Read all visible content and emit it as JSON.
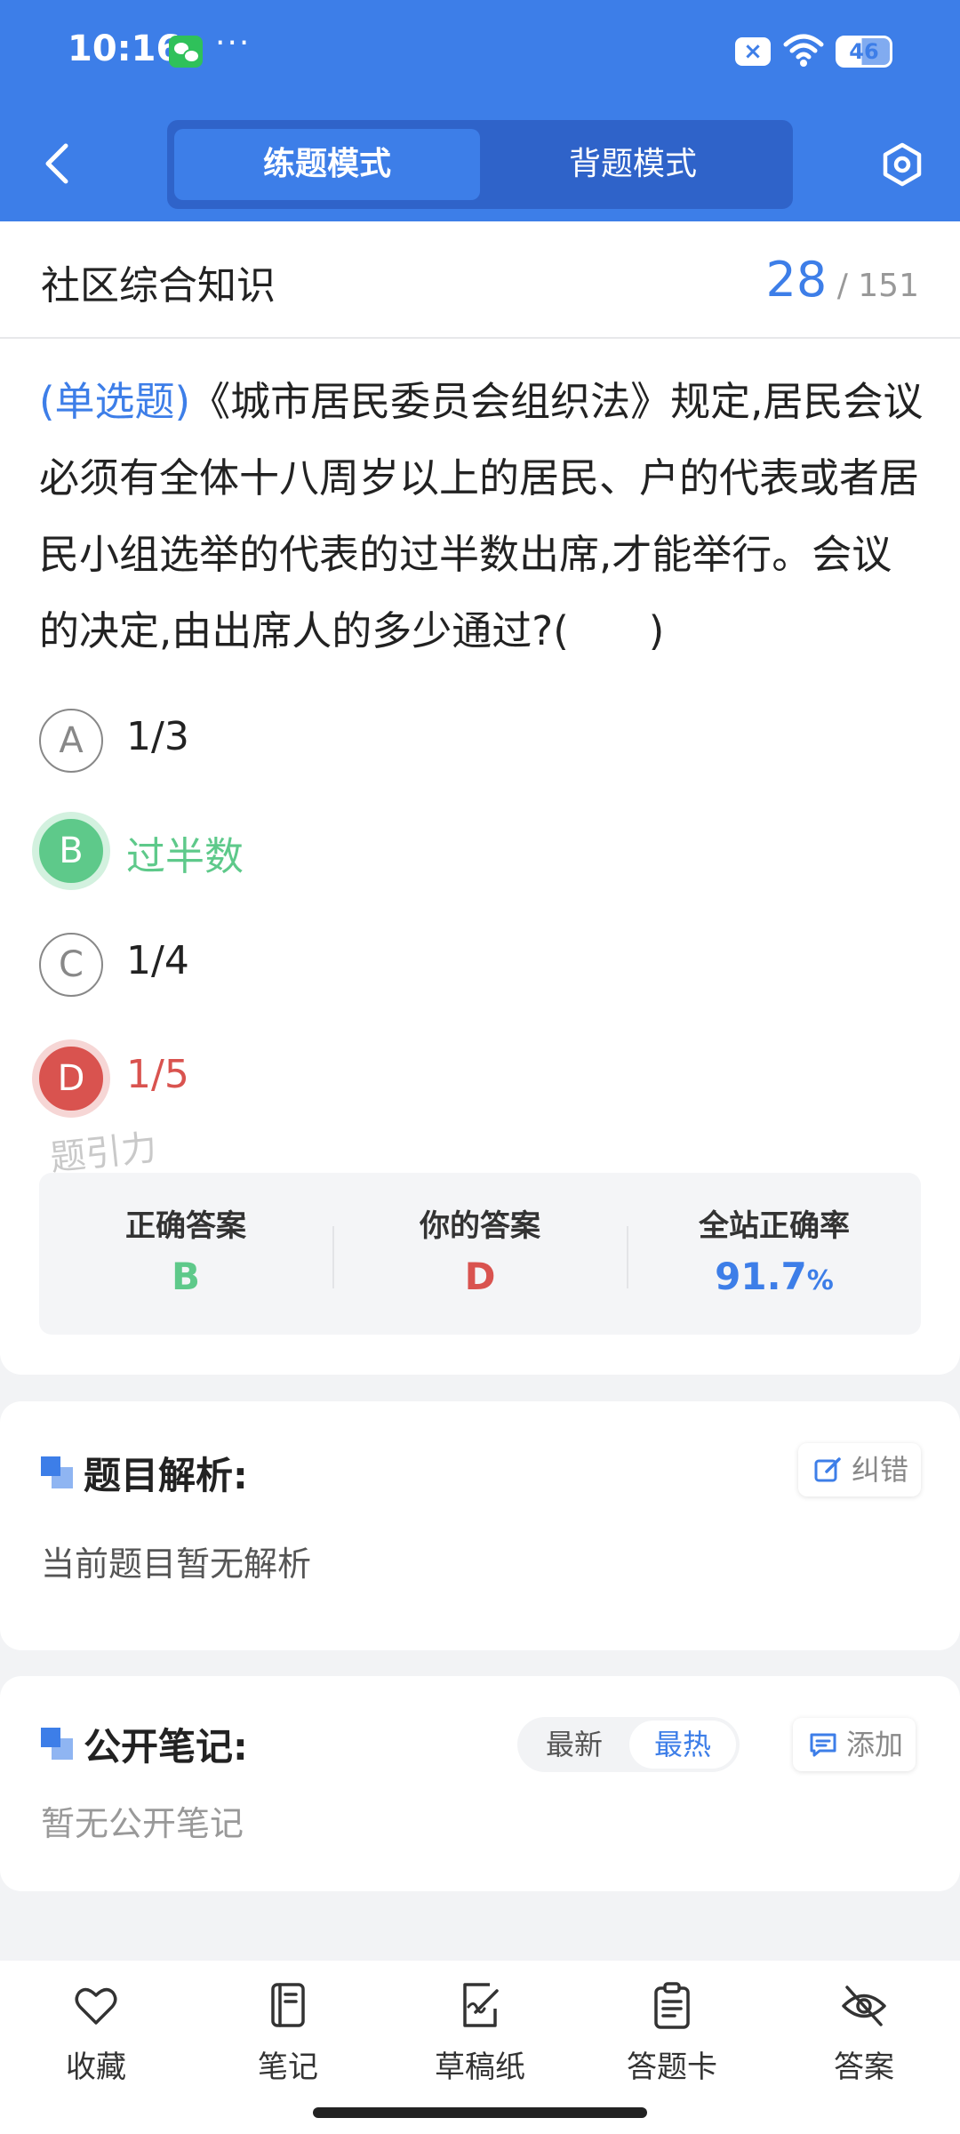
{
  "status_bar": {
    "time": "10:16",
    "more": "···",
    "x_badge": "×",
    "battery": "46"
  },
  "header": {
    "tabs": [
      {
        "label": "练题模式",
        "active": true
      },
      {
        "label": "背题模式",
        "active": false
      }
    ]
  },
  "subject": {
    "title": "社区综合知识",
    "current": "28",
    "separator": "/",
    "total": "151"
  },
  "question": {
    "type": "(单选题)",
    "text": "《城市居民委员会组织法》规定,居民会议必须有全体十八周岁以上的居民、户的代表或者居民小组选举的代表的过半数出席,才能举行。会议的决定,由出席人的多少通过?(　　)"
  },
  "options": [
    {
      "letter": "A",
      "text": "1/3",
      "state": "normal"
    },
    {
      "letter": "B",
      "text": "过半数",
      "state": "correct"
    },
    {
      "letter": "C",
      "text": "1/4",
      "state": "normal"
    },
    {
      "letter": "D",
      "text": "1/5",
      "state": "wrong"
    }
  ],
  "watermark": "题引力",
  "stats": {
    "correct_label": "正确答案",
    "correct_value": "B",
    "yours_label": "你的答案",
    "yours_value": "D",
    "rate_label": "全站正确率",
    "rate_value": "91.7",
    "rate_unit": "%"
  },
  "analysis": {
    "title": "题目解析:",
    "report_button": "纠错",
    "empty_text": "当前题目暂无解析"
  },
  "notes": {
    "title": "公开笔记:",
    "sort_new": "最新",
    "sort_hot": "最热",
    "add_button": "添加",
    "empty_text": "暂无公开笔记"
  },
  "bottom_nav": [
    {
      "label": "收藏",
      "icon": "heart-icon"
    },
    {
      "label": "笔记",
      "icon": "notebook-icon"
    },
    {
      "label": "草稿纸",
      "icon": "draft-icon"
    },
    {
      "label": "答题卡",
      "icon": "clipboard-icon"
    },
    {
      "label": "答案",
      "icon": "eye-off-icon"
    }
  ],
  "colors": {
    "brand": "#3d7ee8",
    "correct": "#5ec98a",
    "wrong": "#d9534f"
  }
}
